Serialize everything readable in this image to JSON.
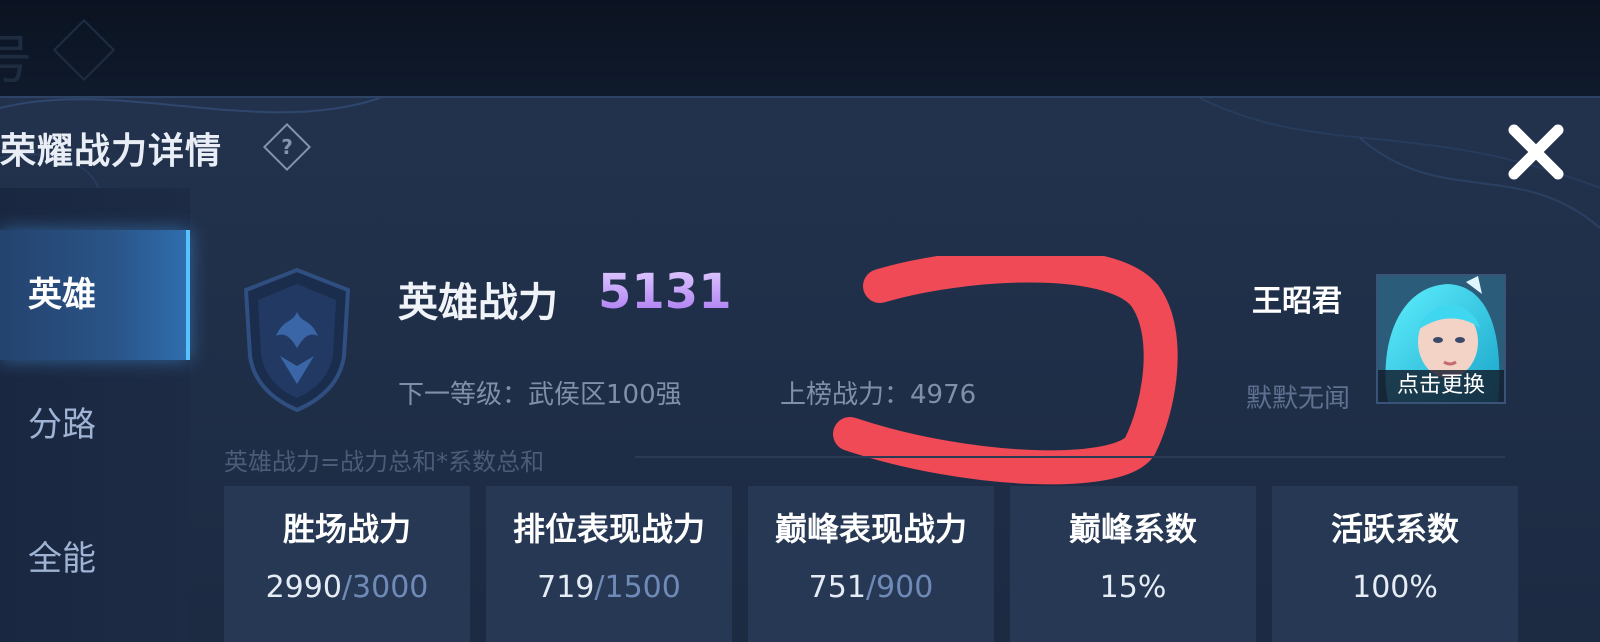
{
  "header": {
    "bg_title_fragment": "号",
    "title": "荣耀战力详情",
    "help_label": "?"
  },
  "sidebar": {
    "items": [
      {
        "label": "英雄",
        "active": true
      },
      {
        "label": "分路",
        "active": false
      },
      {
        "label": "全能",
        "active": false
      }
    ]
  },
  "hero_power": {
    "label": "英雄战力",
    "value": "5131",
    "next_level": "下一等级：武侯区100强",
    "rank_power": "上榜战力：4976",
    "formula": "英雄战力=战力总和*系数总和"
  },
  "hero": {
    "name": "王昭君",
    "subtitle": "默默无闻",
    "change_label": "点击更换"
  },
  "stats": [
    {
      "label": "胜场战力",
      "value": "2990",
      "max": "/3000"
    },
    {
      "label": "排位表现战力",
      "value": "719",
      "max": "/1500"
    },
    {
      "label": "巅峰表现战力",
      "value": "751",
      "max": "/900"
    },
    {
      "label": "巅峰系数",
      "value": "15%",
      "max": ""
    },
    {
      "label": "活跃系数",
      "value": "100%",
      "max": ""
    }
  ],
  "colors": {
    "accent_purple": "#b98cff",
    "annotation_red": "#ef4a55",
    "active_tab": "#2f6fb0"
  }
}
